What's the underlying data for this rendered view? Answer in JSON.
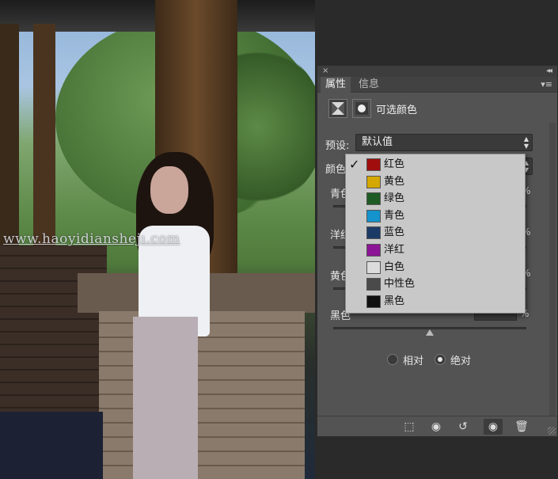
{
  "photo": {
    "watermark": "www.haoyidianshejı.com"
  },
  "panel": {
    "close_glyph": "×",
    "collapse_glyph": "◂◂",
    "menu_glyph": "▾≡",
    "tabs": [
      {
        "label": "属性",
        "active": true
      },
      {
        "label": "信息",
        "active": false
      }
    ],
    "adjustment_title": "可选颜色",
    "preset_label": "预设:",
    "preset_value": "默认值",
    "colors_label": "颜色",
    "sliders": [
      {
        "label": "青色",
        "value_percent": 0
      },
      {
        "label": "洋红",
        "value_percent": 0
      },
      {
        "label": "黄色",
        "value_percent": 0
      },
      {
        "label": "黑色",
        "value_percent": 0
      }
    ],
    "percent_sign": "%",
    "method_options": [
      {
        "label": "相对",
        "checked": false
      },
      {
        "label": "绝对",
        "checked": true
      }
    ],
    "icons": {
      "adjustment_icon": "selective-color-icon",
      "mask_icon": "layer-mask-icon",
      "clip_icon": "clip-to-layer-icon",
      "view_previous_icon": "view-previous-state-icon",
      "reset_icon": "reset-icon",
      "visibility_icon": "eye-icon",
      "delete_icon": "trash-icon"
    }
  },
  "dropdown": {
    "selected_index": 0,
    "items": [
      {
        "label": "红色",
        "color": "#a00d0d"
      },
      {
        "label": "黄色",
        "color": "#d4a800"
      },
      {
        "label": "绿色",
        "color": "#1f5b24"
      },
      {
        "label": "青色",
        "color": "#1493cc"
      },
      {
        "label": "蓝色",
        "color": "#1c3a66"
      },
      {
        "label": "洋红",
        "color": "#8c1496"
      },
      {
        "label": "白色",
        "color": "#dcdcdc"
      },
      {
        "label": "中性色",
        "color": "#4a4a4a"
      },
      {
        "label": "黑色",
        "color": "#111111"
      }
    ]
  }
}
